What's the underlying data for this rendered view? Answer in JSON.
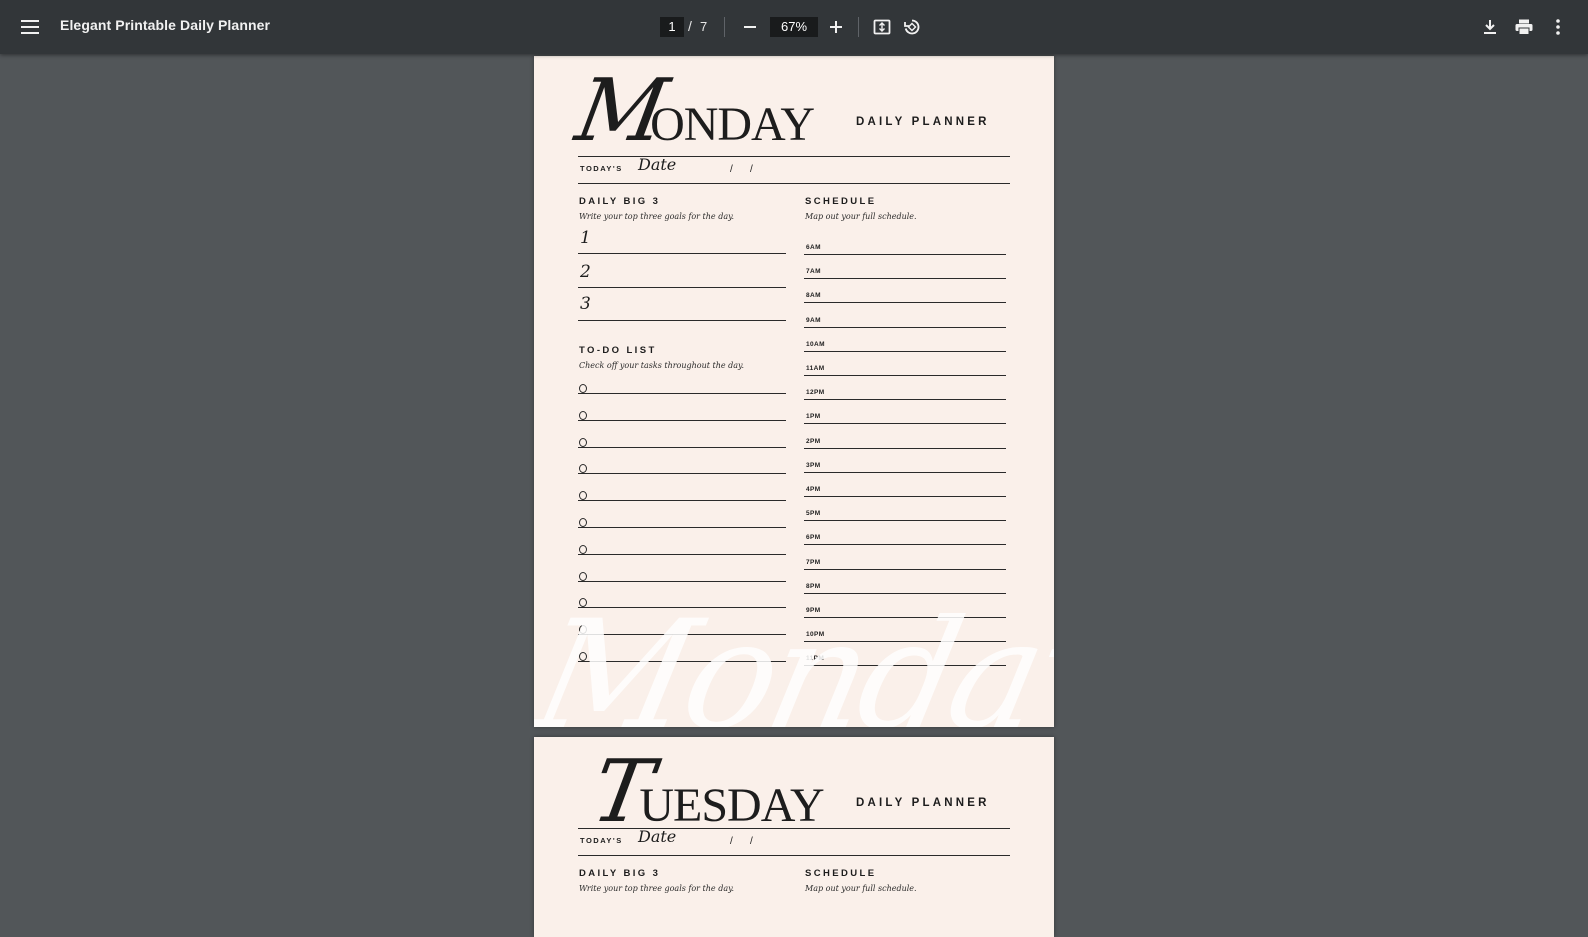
{
  "toolbar": {
    "title": "Elegant Printable Daily Planner",
    "current_page": "1",
    "page_separator": "/",
    "total_pages": "7",
    "zoom": "67%",
    "icons": {
      "menu": "hamburger-menu-icon",
      "zoom_out": "minus-icon",
      "zoom_in": "plus-icon",
      "fit": "fit-to-page-icon",
      "rotate": "rotate-icon",
      "download": "download-icon",
      "print": "print-icon",
      "more": "more-vertical-icon"
    }
  },
  "pages": [
    {
      "day_initial": "M",
      "day_rest": "ONDAY",
      "subtitle": "DAILY PLANNER",
      "date_label": "TODAY'S",
      "date_script": "Date",
      "date_slash": "/",
      "big3_heading": "DAILY BIG 3",
      "big3_sub": "Write your top three goals for the day.",
      "goals": [
        "1",
        "2",
        "3"
      ],
      "todo_heading": "TO-DO LIST",
      "todo_sub": "Check off your tasks throughout the day.",
      "todo_count": 11,
      "schedule_heading": "SCHEDULE",
      "schedule_sub": "Map out your full schedule.",
      "schedule_times": [
        "6AM",
        "7AM",
        "8AM",
        "9AM",
        "10AM",
        "11AM",
        "12PM",
        "1PM",
        "2PM",
        "3PM",
        "4PM",
        "5PM",
        "6PM",
        "7PM",
        "8PM",
        "9PM",
        "10PM",
        "11PM"
      ],
      "watermark": "Monday"
    },
    {
      "day_initial": "T",
      "day_rest": "UESDAY",
      "subtitle": "DAILY PLANNER",
      "date_label": "TODAY'S",
      "date_script": "Date",
      "date_slash": "/",
      "big3_heading": "DAILY BIG 3",
      "big3_sub": "Write your top three goals for the day.",
      "schedule_heading": "SCHEDULE",
      "schedule_sub": "Map out your full schedule."
    }
  ]
}
